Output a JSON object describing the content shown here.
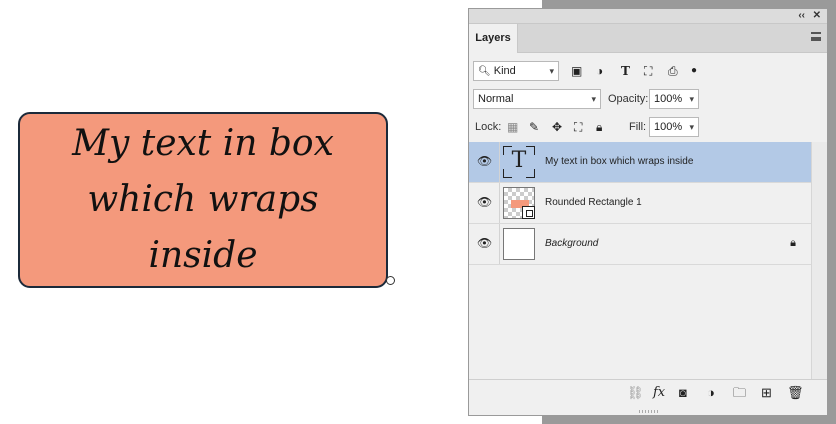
{
  "canvas": {
    "shape_text": "My text in box which wraps inside",
    "shape_fill": "#f4997c",
    "shape_border": "#1b2a3a"
  },
  "panel": {
    "tab_label": "Layers",
    "filter": {
      "kind_label": "Kind",
      "icons": [
        "image-filter-icon",
        "adjustment-filter-icon",
        "type-filter-icon",
        "shape-filter-icon",
        "smart-object-filter-icon",
        "filter-toggle-icon"
      ]
    },
    "blend_mode": "Normal",
    "opacity_label": "Opacity:",
    "opacity_value": "100%",
    "lock_label": "Lock:",
    "fill_label": "Fill:",
    "fill_value": "100%",
    "layers": [
      {
        "name": "My text in box which wraps inside",
        "type": "text",
        "selected": true
      },
      {
        "name": "Rounded Rectangle 1",
        "type": "shape",
        "selected": false
      },
      {
        "name": "Background",
        "type": "background",
        "selected": false,
        "locked": true
      }
    ],
    "footer_icons": [
      "link-layers-icon",
      "fx-icon",
      "add-mask-icon",
      "new-adjustment-icon",
      "new-group-icon",
      "new-layer-icon",
      "delete-layer-icon"
    ],
    "selected_color": "#b3c9e6"
  }
}
